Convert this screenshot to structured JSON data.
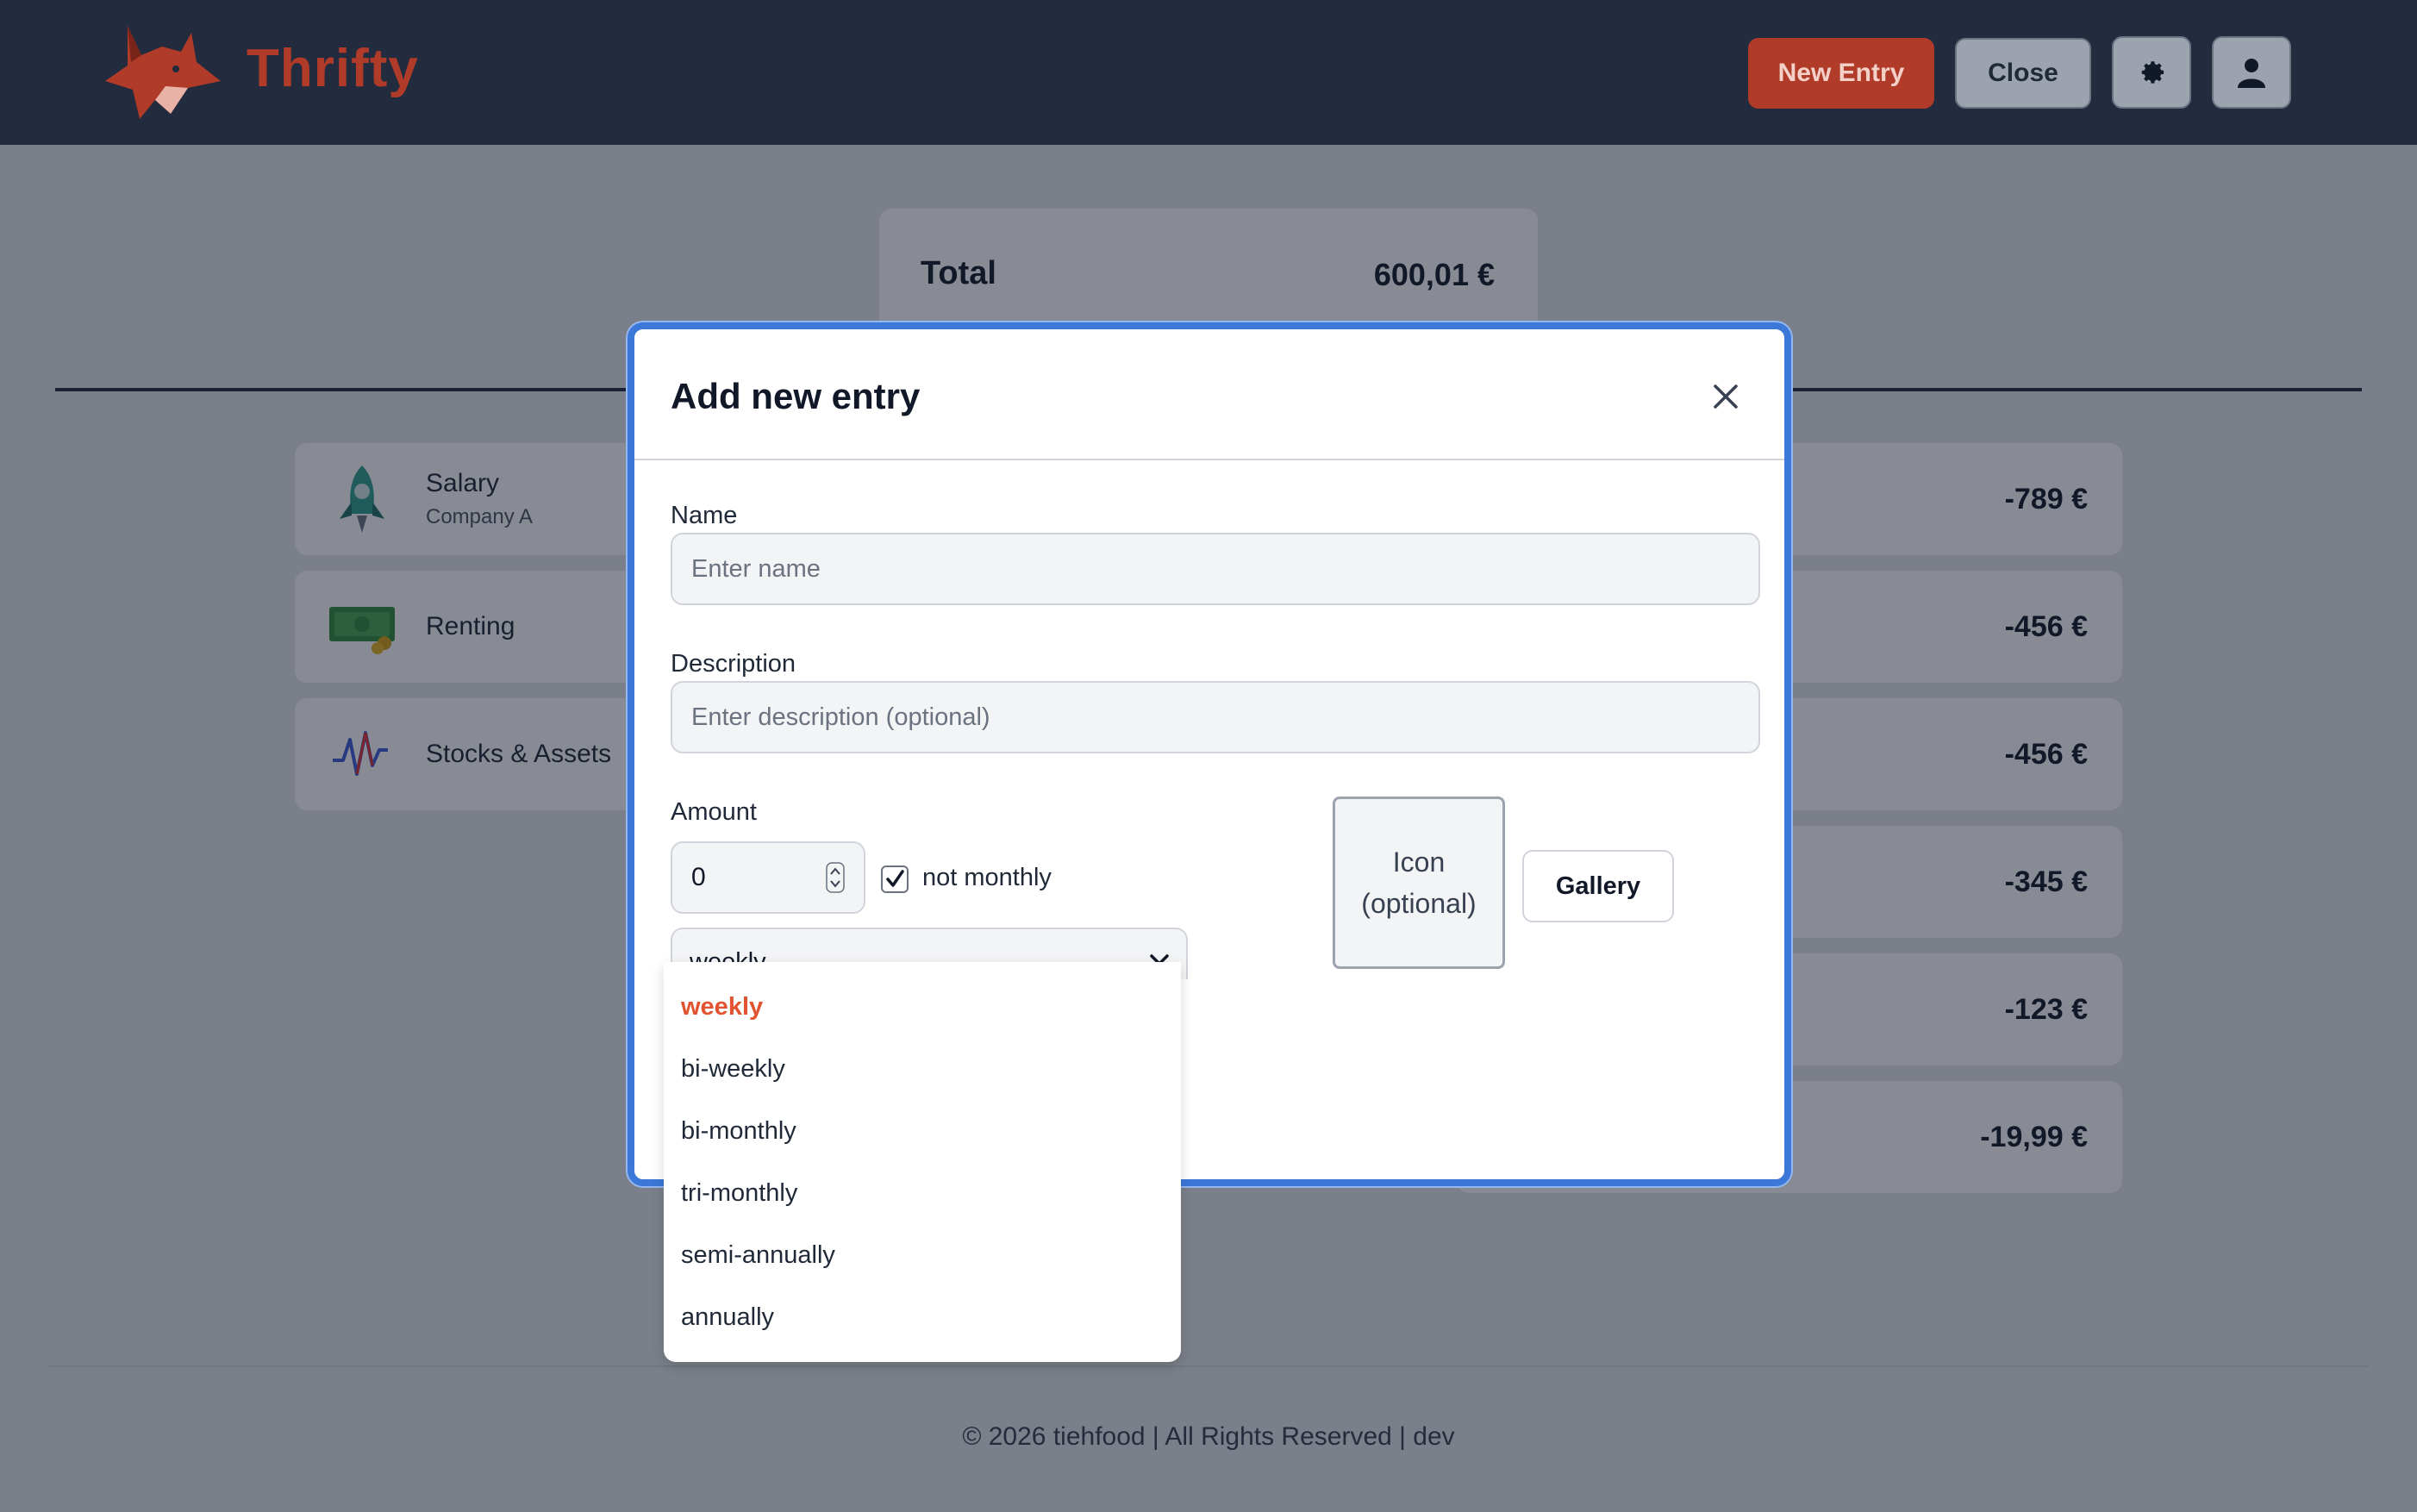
{
  "app": {
    "brand": "Thrifty",
    "new_entry_label": "New Entry",
    "close_label": "Close",
    "icons": {
      "settings": "gear-icon",
      "user": "user-icon",
      "logo": "fox-logo"
    }
  },
  "colors": {
    "header": "#232b3e",
    "accent": "#b03b29",
    "focus": "#3b78d8",
    "selected_option": "#e2532f"
  },
  "summary": {
    "total_label": "Total",
    "total_value": "600,01 €"
  },
  "income": [
    {
      "title": "Salary",
      "subtitle": "Company A",
      "icon": "rocket-icon"
    },
    {
      "title": "Renting",
      "subtitle": "",
      "icon": "money-icon"
    },
    {
      "title": "Stocks & Assets",
      "subtitle": "",
      "icon": "chart-icon"
    }
  ],
  "expenses": [
    {
      "amount": "-789 €"
    },
    {
      "amount": "-456 €"
    },
    {
      "amount": "-456 €"
    },
    {
      "amount": "-345 €"
    },
    {
      "amount": "-123 €"
    },
    {
      "amount": "-19,99 €"
    }
  ],
  "modal": {
    "title": "Add new entry",
    "name_label": "Name",
    "name_placeholder": "Enter name",
    "description_label": "Description",
    "description_placeholder": "Enter description (optional)",
    "amount_label": "Amount",
    "amount_value": "0",
    "not_monthly_label": "not monthly",
    "not_monthly_checked": true,
    "frequency_value": "weekly",
    "frequency_options": [
      "weekly",
      "bi-weekly",
      "bi-monthly",
      "tri-monthly",
      "semi-annually",
      "annually"
    ],
    "icon_line1": "Icon",
    "icon_line2": "(optional)",
    "gallery_label": "Gallery"
  },
  "footer": {
    "text": "© 2026 tiehfood | All Rights Reserved | dev"
  }
}
